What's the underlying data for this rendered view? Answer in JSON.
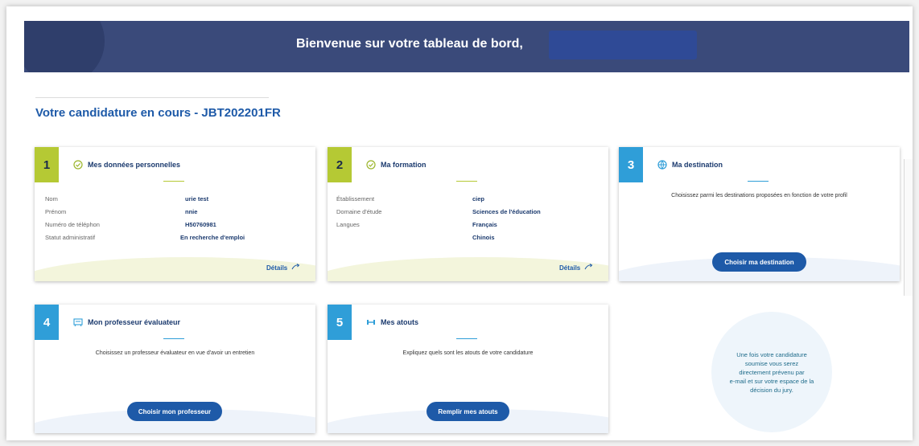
{
  "banner": {
    "title": "Bienvenue sur votre tableau de bord,"
  },
  "section": {
    "title": "Votre candidature en cours - JBT202201FR"
  },
  "cards": {
    "c1": {
      "number": "1",
      "title": "Mes données personnelles",
      "icon": "check-circle-icon",
      "rows": [
        {
          "label": "Nom",
          "value": "urie test"
        },
        {
          "label": "Prénom",
          "value": "nnie"
        },
        {
          "label": "Numéro de téléphon",
          "value": "H50760981"
        },
        {
          "label": "Statut administratif",
          "value": "En recherche d'emploi"
        }
      ],
      "details": "Détails"
    },
    "c2": {
      "number": "2",
      "title": "Ma formation",
      "icon": "check-circle-icon",
      "rows": [
        {
          "label": "Établissement",
          "value": "ciep"
        },
        {
          "label": "Domaine d'étude",
          "value": "Sciences de l'éducation"
        },
        {
          "label": "Langues",
          "value": "Français"
        },
        {
          "label": "",
          "value": "Chinois"
        }
      ],
      "details": "Détails"
    },
    "c3": {
      "number": "3",
      "title": "Ma destination",
      "icon": "globe-icon",
      "description": "Choisissez parmi les destinations proposées en fonction de votre profil",
      "button": "Choisir ma destination"
    },
    "c4": {
      "number": "4",
      "title": "Mon professeur évaluateur",
      "icon": "teacher-board-icon",
      "description": "Choisissez un professeur évaluateur en vue d'avoir un entretien",
      "button": "Choisir mon professeur"
    },
    "c5": {
      "number": "5",
      "title": "Mes atouts",
      "icon": "dumbbell-icon",
      "description": "Expliquez quels sont les atouts de votre candidature",
      "button": "Remplir mes atouts"
    }
  },
  "info": {
    "lines": [
      "Une fois votre candidature",
      "soumise vous serez",
      "directement prévenu par",
      "e-mail et sur votre espace de la",
      "décision du jury."
    ]
  },
  "colors": {
    "accent": "#1e5aa8",
    "green": "#b5c934",
    "blue": "#2f9ed8",
    "banner": "#3a4a7a"
  }
}
